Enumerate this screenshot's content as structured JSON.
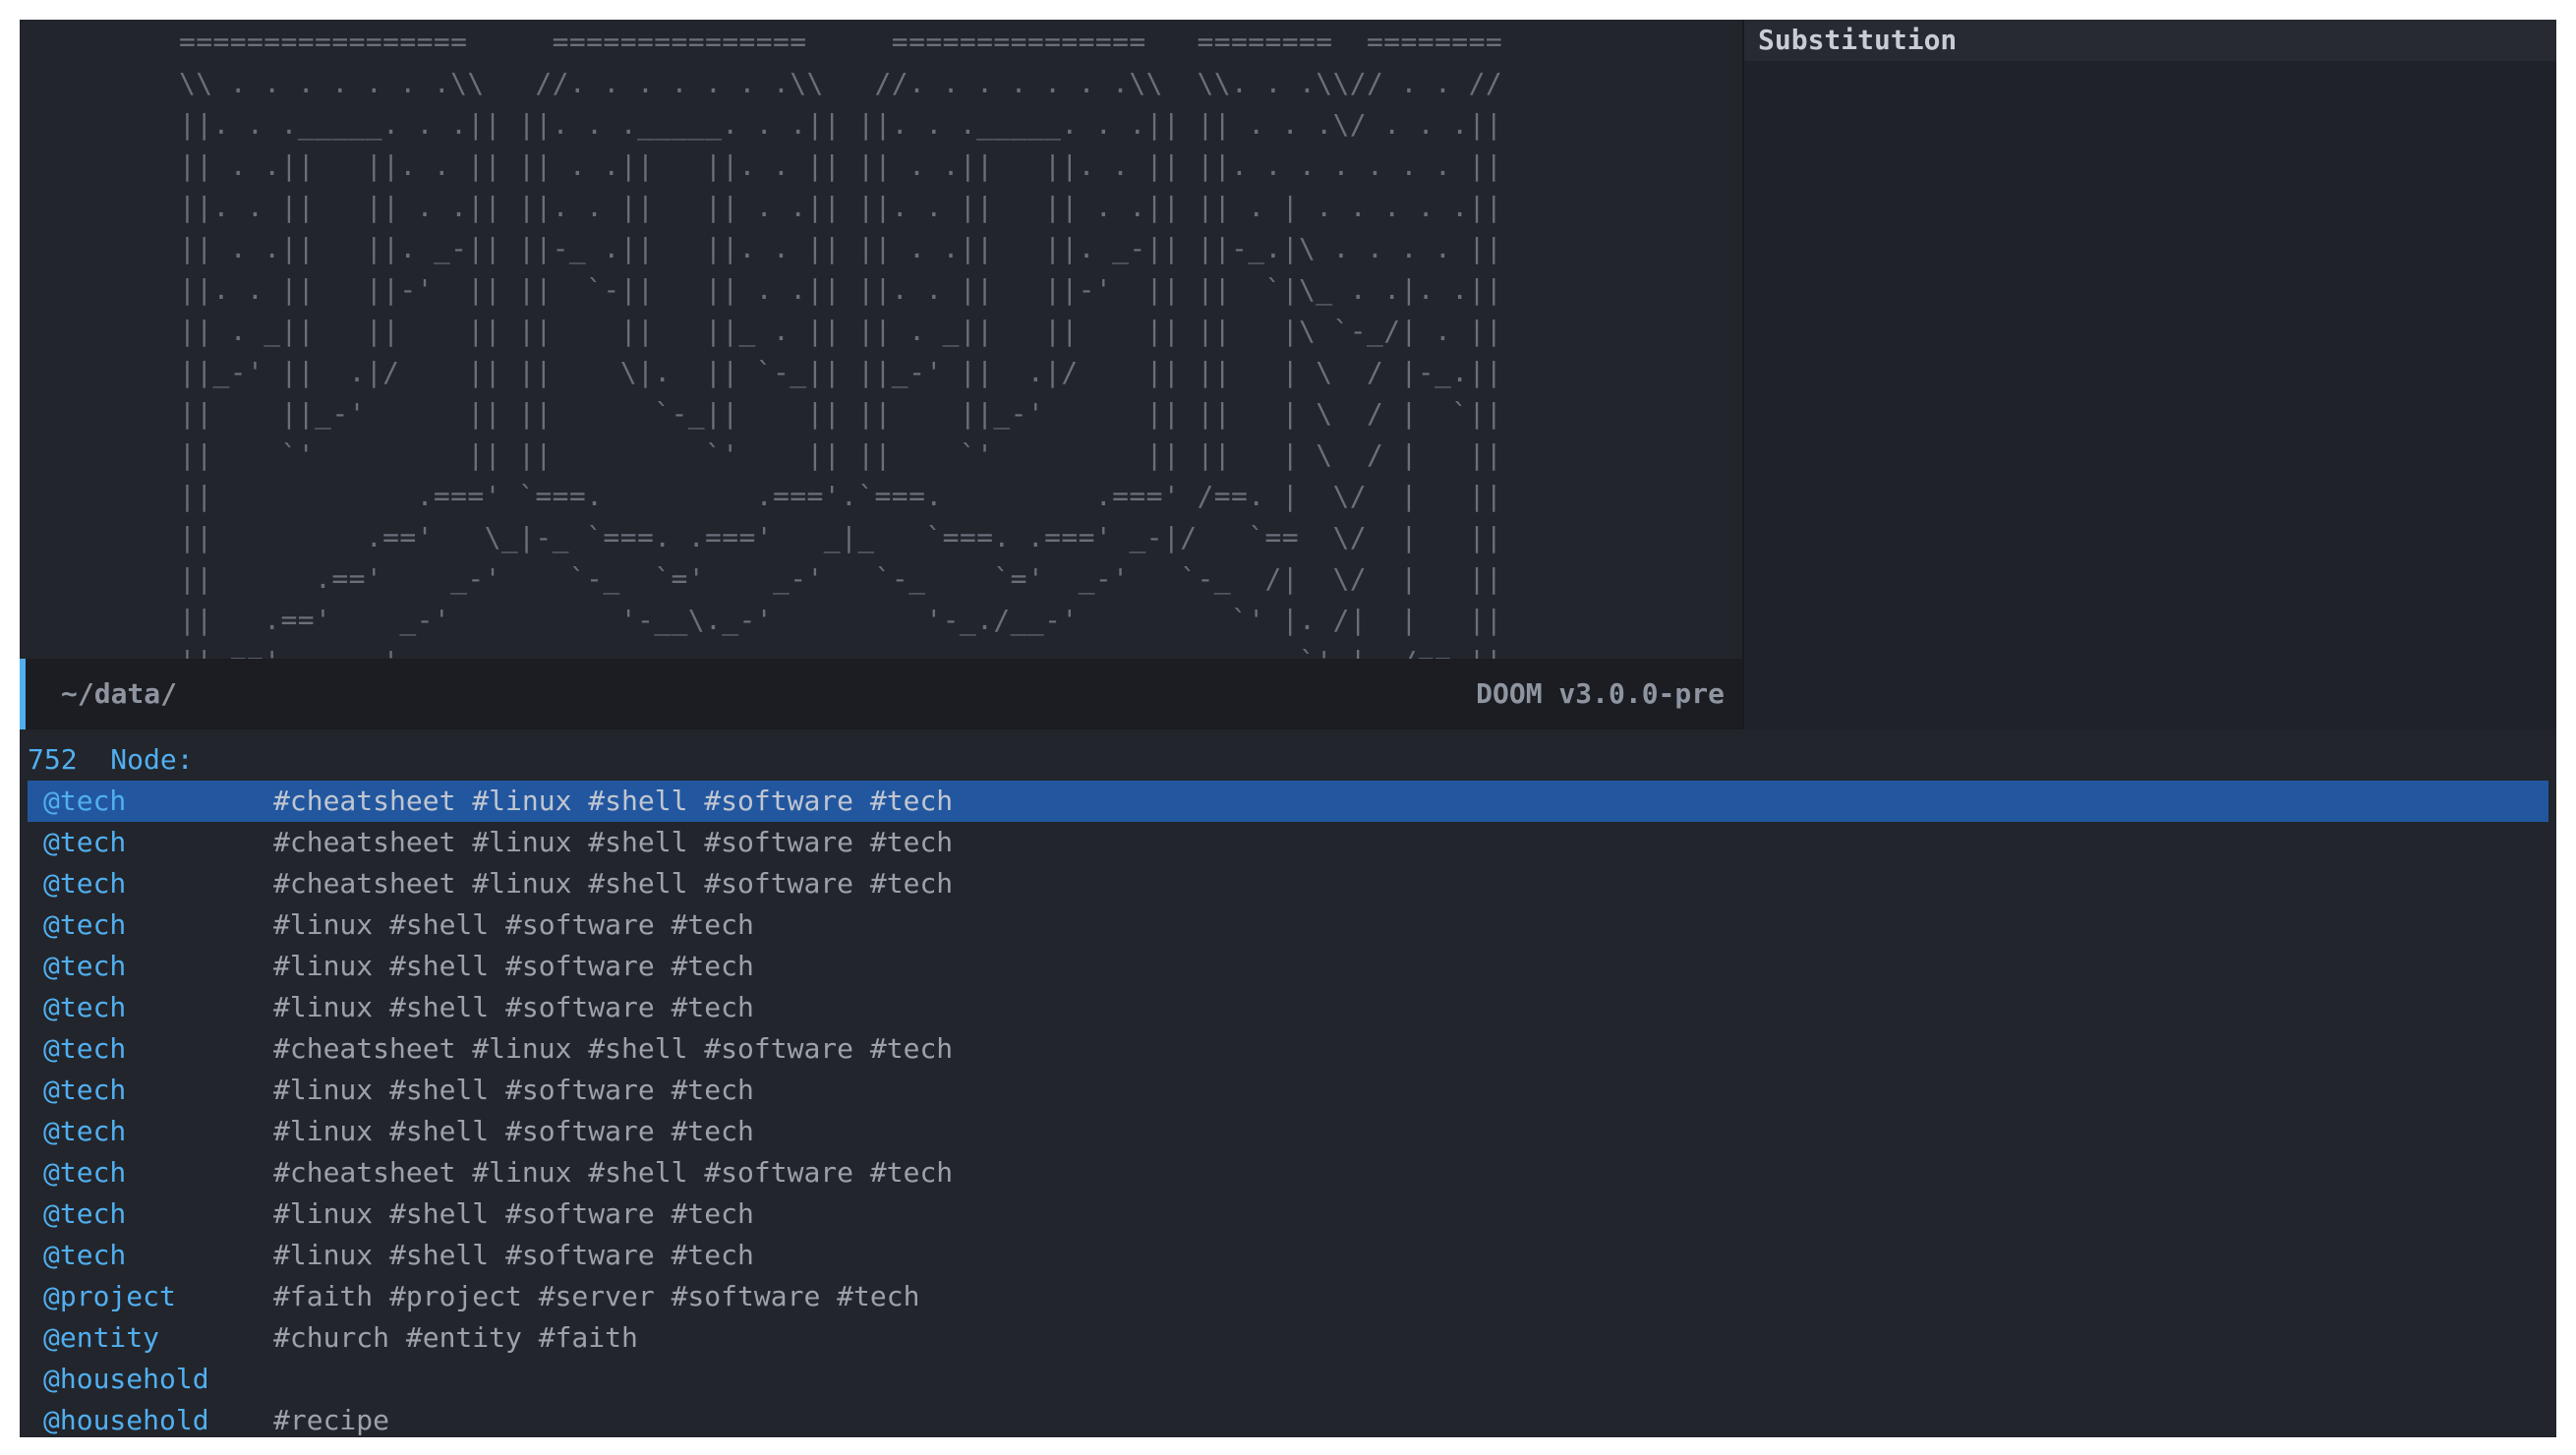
{
  "banner": {
    "ascii_art": "=================     ===============     ===============   ========  ========\n\\\\ . . . . . . .\\\\   //. . . . . . .\\\\   //. . . . . . .\\\\  \\\\. . .\\\\// . . //\n||. . ._____. . .|| ||. . ._____. . .|| ||. . ._____. . .|| || . . .\\/ . . .||\n|| . .||   ||. . || || . .||   ||. . || || . .||   ||. . || ||. . . . . . . ||\n||. . ||   || . .|| ||. . ||   || . .|| ||. . ||   || . .|| || . | . . . . .||\n|| . .||   ||. _-|| ||-_ .||   ||. . || || . .||   ||. _-|| ||-_.|\\ . . . . ||\n||. . ||   ||-'  || ||  `-||   || . .|| ||. . ||   ||-'  || ||  `|\\_ . .|. .||\n|| . _||   ||    || ||    ||   ||_ . || || . _||   ||    || ||   |\\ `-_/| . ||\n||_-' ||  .|/    || ||    \\|.  || `-_|| ||_-' ||  .|/    || ||   | \\  / |-_.||\n||    ||_-'      || ||      `-_||    || ||    ||_-'      || ||   | \\  / |  `||\n||    `'         || ||         `'    || ||    `'         || ||   | \\  / |   ||\n||            .===' `===.         .==='.`===.         .===' /==. |  \\/  |   ||\n||         .=='   \\_|-_ `===. .==='   _|_   `===. .===' _-|/   `==  \\/  |   ||\n||      .=='    _-'    `-_  `='    _-'   `-_    `='  _-'   `-_  /|  \\/  |   ||\n||   .=='    _-'          '-__\\._-'         '-_./__-'         `' |. /|  |   ||\n||.=='    _-'                                                     `' |  /==.||"
  },
  "side_pane": {
    "title": "Substitution"
  },
  "modeline": {
    "path": "~/data/",
    "version": "DOOM v3.0.0-pre"
  },
  "minibuffer": {
    "count": "752",
    "prompt_label": "Node:",
    "candidates": [
      {
        "title": "@tech",
        "tags": "#cheatsheet #linux #shell #software #tech"
      },
      {
        "title": "@tech",
        "tags": "#cheatsheet #linux #shell #software #tech"
      },
      {
        "title": "@tech",
        "tags": "#cheatsheet #linux #shell #software #tech"
      },
      {
        "title": "@tech",
        "tags": "#linux #shell #software #tech"
      },
      {
        "title": "@tech",
        "tags": "#linux #shell #software #tech"
      },
      {
        "title": "@tech",
        "tags": "#linux #shell #software #tech"
      },
      {
        "title": "@tech",
        "tags": "#cheatsheet #linux #shell #software #tech"
      },
      {
        "title": "@tech",
        "tags": "#linux #shell #software #tech"
      },
      {
        "title": "@tech",
        "tags": "#linux #shell #software #tech"
      },
      {
        "title": "@tech",
        "tags": "#cheatsheet #linux #shell #software #tech"
      },
      {
        "title": "@tech",
        "tags": "#linux #shell #software #tech"
      },
      {
        "title": "@tech",
        "tags": "#linux #shell #software #tech"
      },
      {
        "title": "@project",
        "tags": "#faith #project #server #software #tech"
      },
      {
        "title": "@entity",
        "tags": "#church #entity #faith"
      },
      {
        "title": "@household",
        "tags": ""
      },
      {
        "title": "@household",
        "tags": "#recipe"
      }
    ]
  },
  "colors": {
    "background": "#22252c",
    "accent": "#51afef",
    "selection": "#2257a0",
    "dim_text": "#9ca1aa"
  }
}
